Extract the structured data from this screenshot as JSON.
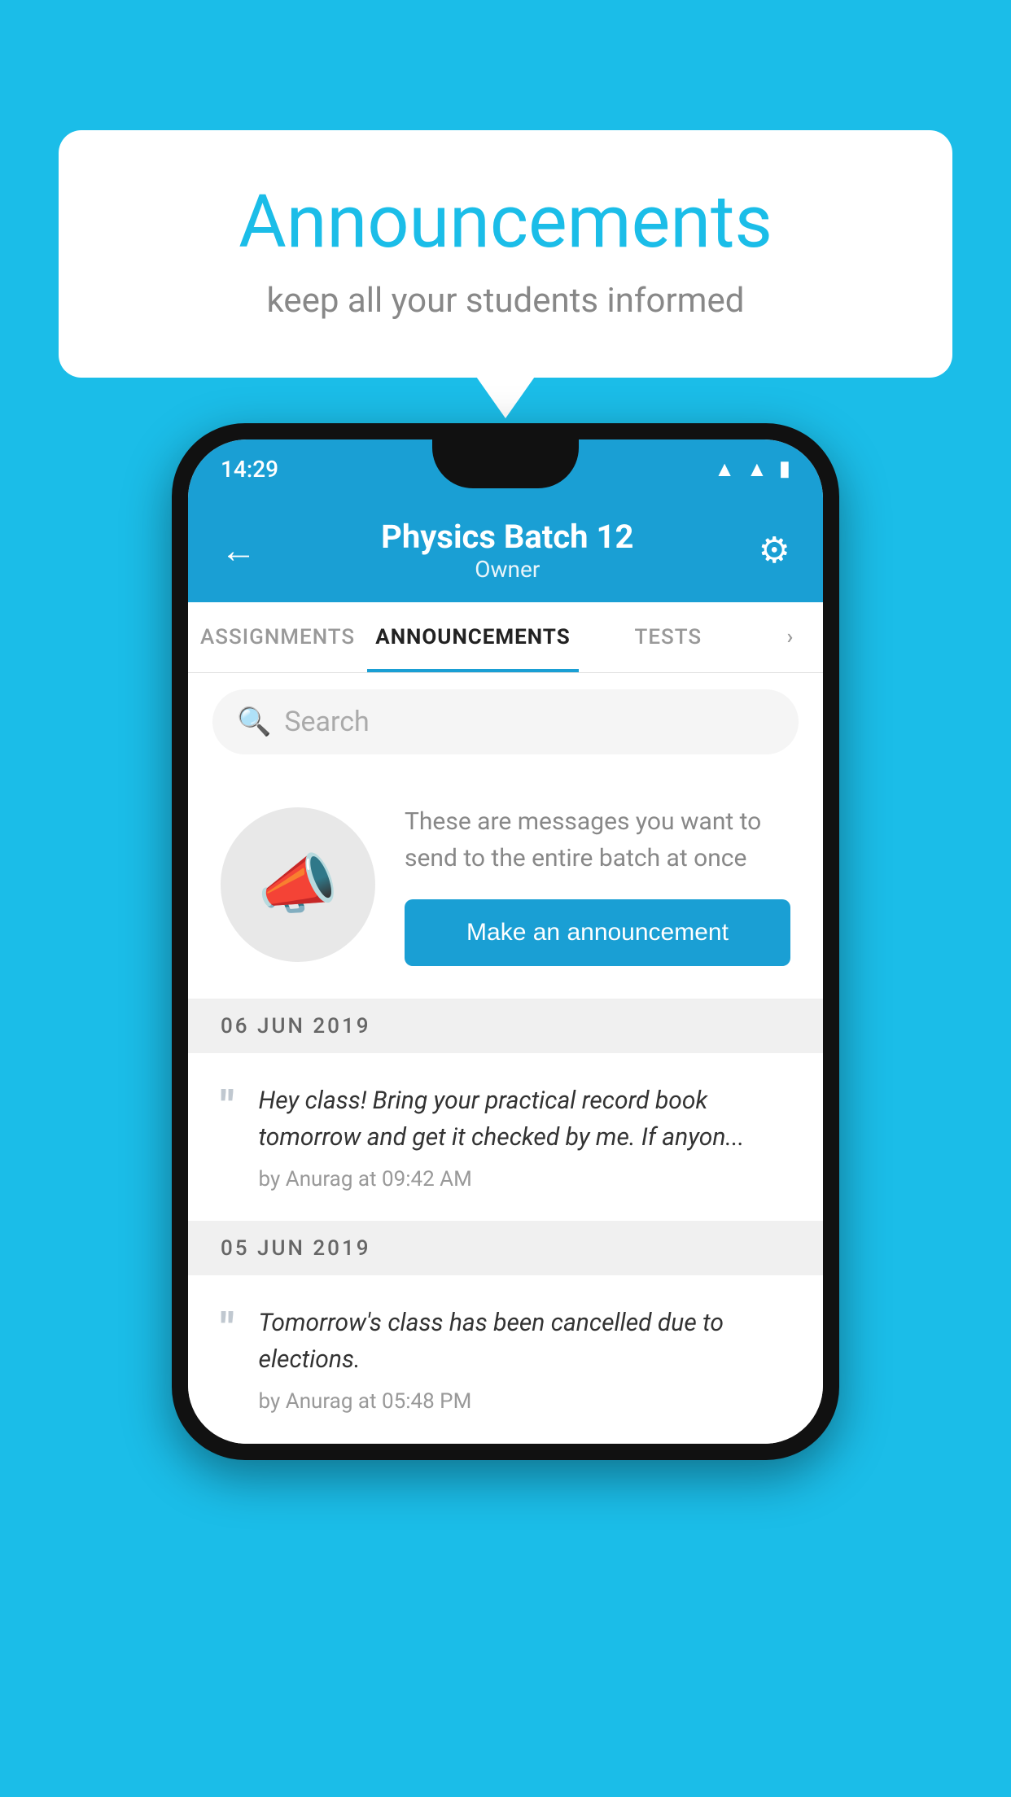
{
  "background": {
    "color": "#1bbde8"
  },
  "speech_bubble": {
    "title": "Announcements",
    "subtitle": "keep all your students informed"
  },
  "status_bar": {
    "time": "14:29",
    "icons": [
      "wifi",
      "signal",
      "battery"
    ]
  },
  "app_header": {
    "title": "Physics Batch 12",
    "subtitle": "Owner",
    "back_label": "←",
    "settings_label": "⚙"
  },
  "tabs": [
    {
      "label": "ASSIGNMENTS",
      "active": false
    },
    {
      "label": "ANNOUNCEMENTS",
      "active": true
    },
    {
      "label": "TESTS",
      "active": false
    },
    {
      "label": "...",
      "active": false
    }
  ],
  "search": {
    "placeholder": "Search"
  },
  "promo": {
    "description": "These are messages you want to send to the entire batch at once",
    "button_label": "Make an announcement"
  },
  "announcements": [
    {
      "date": "06  JUN  2019",
      "text": "Hey class! Bring your practical record book tomorrow and get it checked by me. If anyon...",
      "meta": "by Anurag at 09:42 AM"
    },
    {
      "date": "05  JUN  2019",
      "text": "Tomorrow's class has been cancelled due to elections.",
      "meta": "by Anurag at 05:48 PM"
    }
  ]
}
